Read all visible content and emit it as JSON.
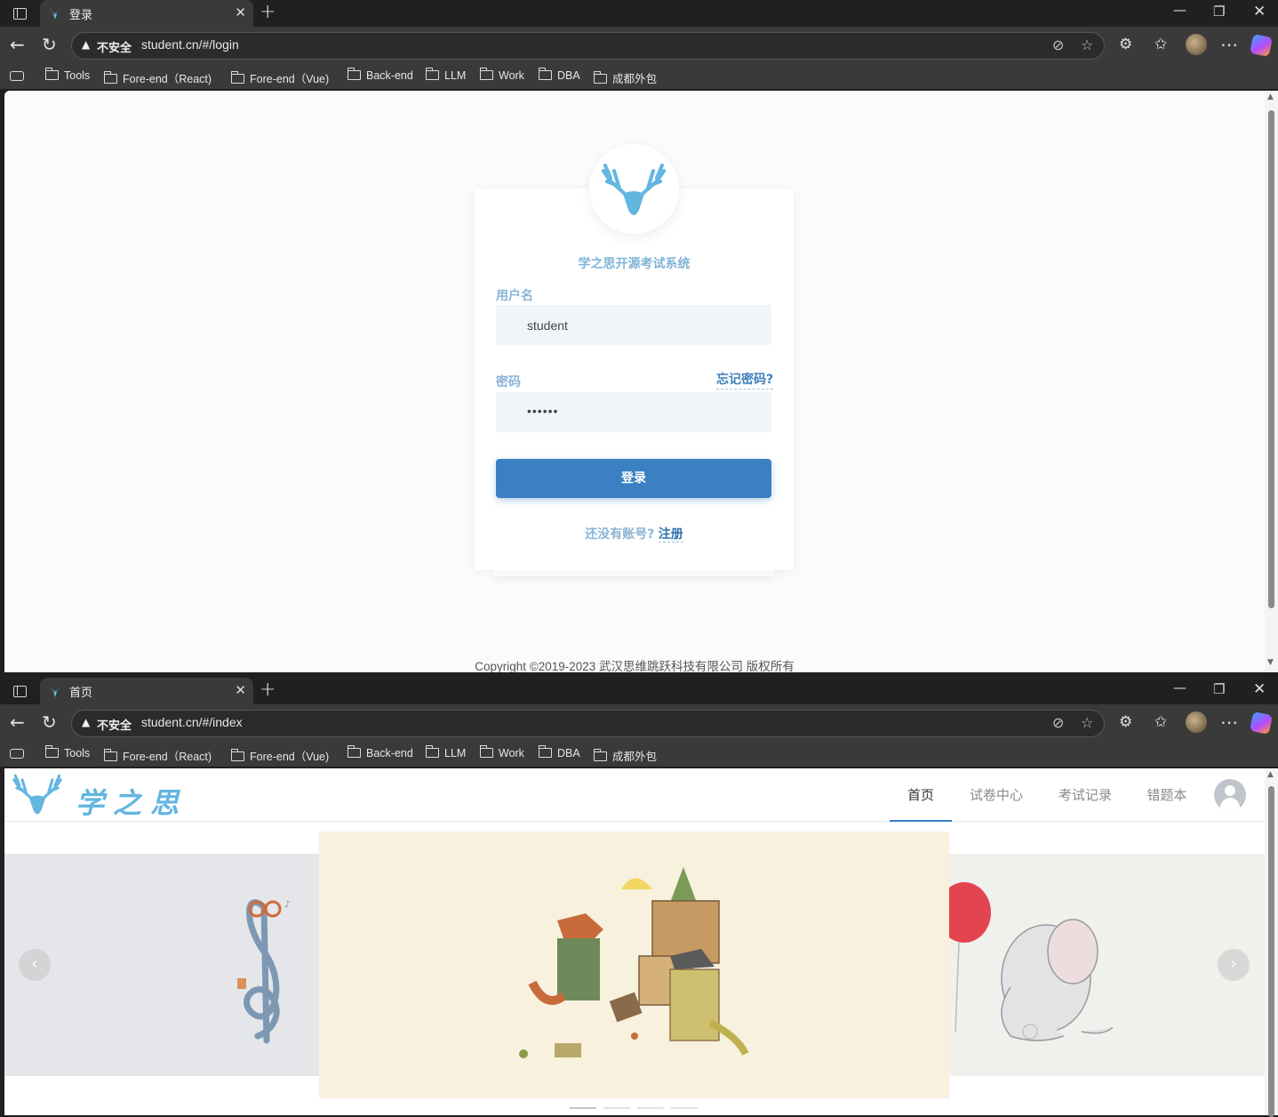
{
  "browser": {
    "bookmarks": [
      "Tools",
      "Fore-end（React)",
      "Fore-end（Vue)",
      "Back-end",
      "LLM",
      "Work",
      "DBA",
      "成都外包"
    ],
    "insecure_label": "不安全",
    "icons": [
      "tab-actions-icon",
      "back-icon",
      "refresh-icon",
      "tracking-prevention-icon",
      "favorite-star-icon",
      "extensions-icon",
      "favorites-icon",
      "more-icon",
      "copilot-icon"
    ]
  },
  "window1": {
    "tab_title": "登录",
    "url": "student.cn/#/login",
    "login": {
      "system_title": "学之思开源考试系统",
      "username_label": "用户名",
      "username_value": "student",
      "password_label": "密码",
      "password_value": "••••••",
      "forgot_link": "忘记密码?",
      "login_button": "登录",
      "no_account_text": "还没有账号?",
      "register_link": "注册"
    },
    "copyright": "Copyright ©2019-2023 武汉思维跳跃科技有限公司 版权所有"
  },
  "window2": {
    "tab_title": "首页",
    "url": "student.cn/#/index",
    "brand": "学之思",
    "nav": [
      "首页",
      "试卷中心",
      "考试记录",
      "错题本"
    ],
    "active_nav": "首页",
    "carousel": {
      "prev_symbol": "‹",
      "next_symbol": "›",
      "slide_count": 4,
      "active_index": 0
    }
  },
  "colors": {
    "accent": "#3a80c2",
    "logo_blue": "#62b6e0",
    "label_blue": "#8ab4d6"
  }
}
